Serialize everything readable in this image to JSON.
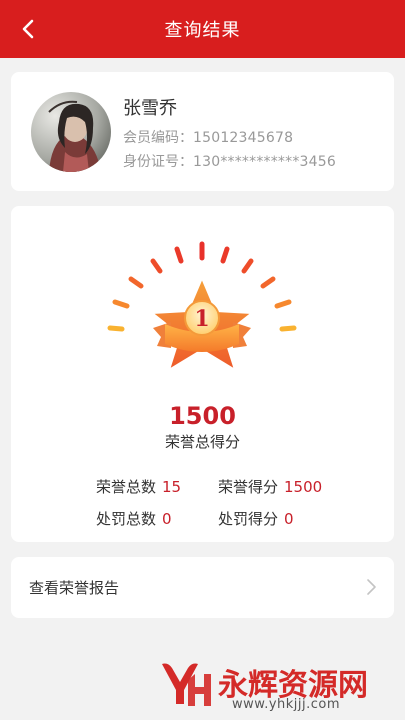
{
  "header": {
    "title": "查询结果",
    "back_icon": "chevron-left-icon",
    "color": "#d81e1e"
  },
  "profile": {
    "name": "张雪乔",
    "member_id_label": "会员编码：",
    "member_id": "15012345678",
    "id_card_label": "身份证号：",
    "id_card": "130***********3456"
  },
  "honor": {
    "medal_number": "1",
    "total_score": "1500",
    "total_label": "荣誉总得分",
    "stats": [
      {
        "label": "荣誉总数",
        "value": "15"
      },
      {
        "label": "荣誉得分",
        "value": "1500"
      },
      {
        "label": "处罚总数",
        "value": "0"
      },
      {
        "label": "处罚得分",
        "value": "0"
      }
    ],
    "accent_color": "#c8202a"
  },
  "report": {
    "label": "查看荣誉报告",
    "icon": "chevron-right-icon"
  },
  "watermark": {
    "title": "永辉资源网",
    "url": "www.yhkjjj.com"
  }
}
